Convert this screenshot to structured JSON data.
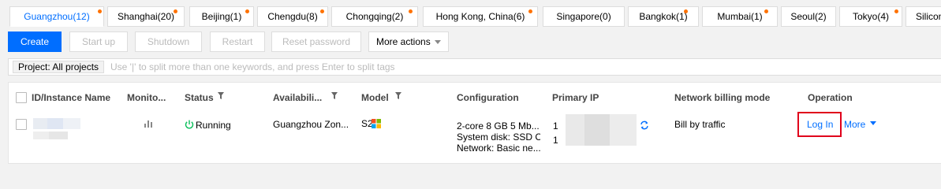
{
  "regions": [
    {
      "label": "Guangzhou(12)",
      "dot": true,
      "active": true
    },
    {
      "label": "Shanghai(20)",
      "dot": true,
      "active": false
    },
    {
      "label": "Beijing(1)",
      "dot": true,
      "active": false
    },
    {
      "label": "Chengdu(8)",
      "dot": true,
      "active": false
    },
    {
      "label": "Chongqing(2)",
      "dot": true,
      "active": false
    },
    {
      "label": "Hong Kong, China(6)",
      "dot": true,
      "active": false
    },
    {
      "label": "Singapore(0)",
      "dot": false,
      "active": false
    },
    {
      "label": "Bangkok(1)",
      "dot": true,
      "active": false
    },
    {
      "label": "Mumbai(1)",
      "dot": true,
      "active": false
    },
    {
      "label": "Seoul(2)",
      "dot": false,
      "active": false
    },
    {
      "label": "Tokyo(4)",
      "dot": true,
      "active": false
    },
    {
      "label": "Silicon",
      "dot": false,
      "active": false
    }
  ],
  "toolbar": {
    "create": "Create",
    "start_up": "Start up",
    "shutdown": "Shutdown",
    "restart": "Restart",
    "reset_password": "Reset password",
    "more_actions": "More actions"
  },
  "search": {
    "tag": "Project: All projects",
    "placeholder": "Use '|' to split more than one keywords, and press Enter to split tags"
  },
  "table": {
    "headers": {
      "id_name": "ID/Instance Name",
      "monitoring": "Monito...",
      "status": "Status",
      "availability_zone": "Availabili...",
      "model": "Model",
      "configuration": "Configuration",
      "primary_ip": "Primary IP",
      "network_billing": "Network billing mode",
      "operation": "Operation"
    },
    "row": {
      "status": "Running",
      "zone": "Guangzhou Zon...",
      "model": "S2",
      "config_line1": "2-core 8 GB 5 Mb...",
      "config_line2": "System disk: SSD Cl",
      "config_line3": "Network: Basic ne...",
      "ip_prefix1": "1",
      "ip_prefix2": "1",
      "billing": "Bill by traffic",
      "login": "Log In",
      "more": "More"
    }
  },
  "colors": {
    "accent": "#006eff",
    "running": "#0abf5b",
    "badge_dot": "#ff7200",
    "highlight": "#e0001b"
  }
}
